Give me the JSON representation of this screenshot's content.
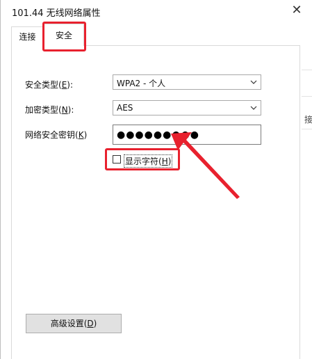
{
  "window": {
    "title": "101.44 无线网络属性",
    "close_glyph": "✕"
  },
  "tabs": [
    {
      "label": "连接"
    },
    {
      "label": "安全"
    }
  ],
  "form": {
    "security_type": {
      "label_pre": "安全类型(",
      "label_key": "E",
      "label_post": "):",
      "value": "WPA2 - 个人"
    },
    "encryption_type": {
      "label_pre": "加密类型(",
      "label_key": "N",
      "label_post": "):",
      "value": "AES"
    },
    "network_key": {
      "label_pre": "网络安全密钥(",
      "label_key": "K",
      "label_post": ")",
      "value": "●●●●●●●●●"
    },
    "show_chars": {
      "label_pre": "显示字符(",
      "label_key": "H",
      "label_post": ")",
      "checked": false
    }
  },
  "advanced_button": {
    "label_pre": "高级设置(",
    "label_key": "D",
    "label_post": ")"
  },
  "background": {
    "glyph": "接"
  },
  "annotation": {
    "color": "#e8212e"
  }
}
